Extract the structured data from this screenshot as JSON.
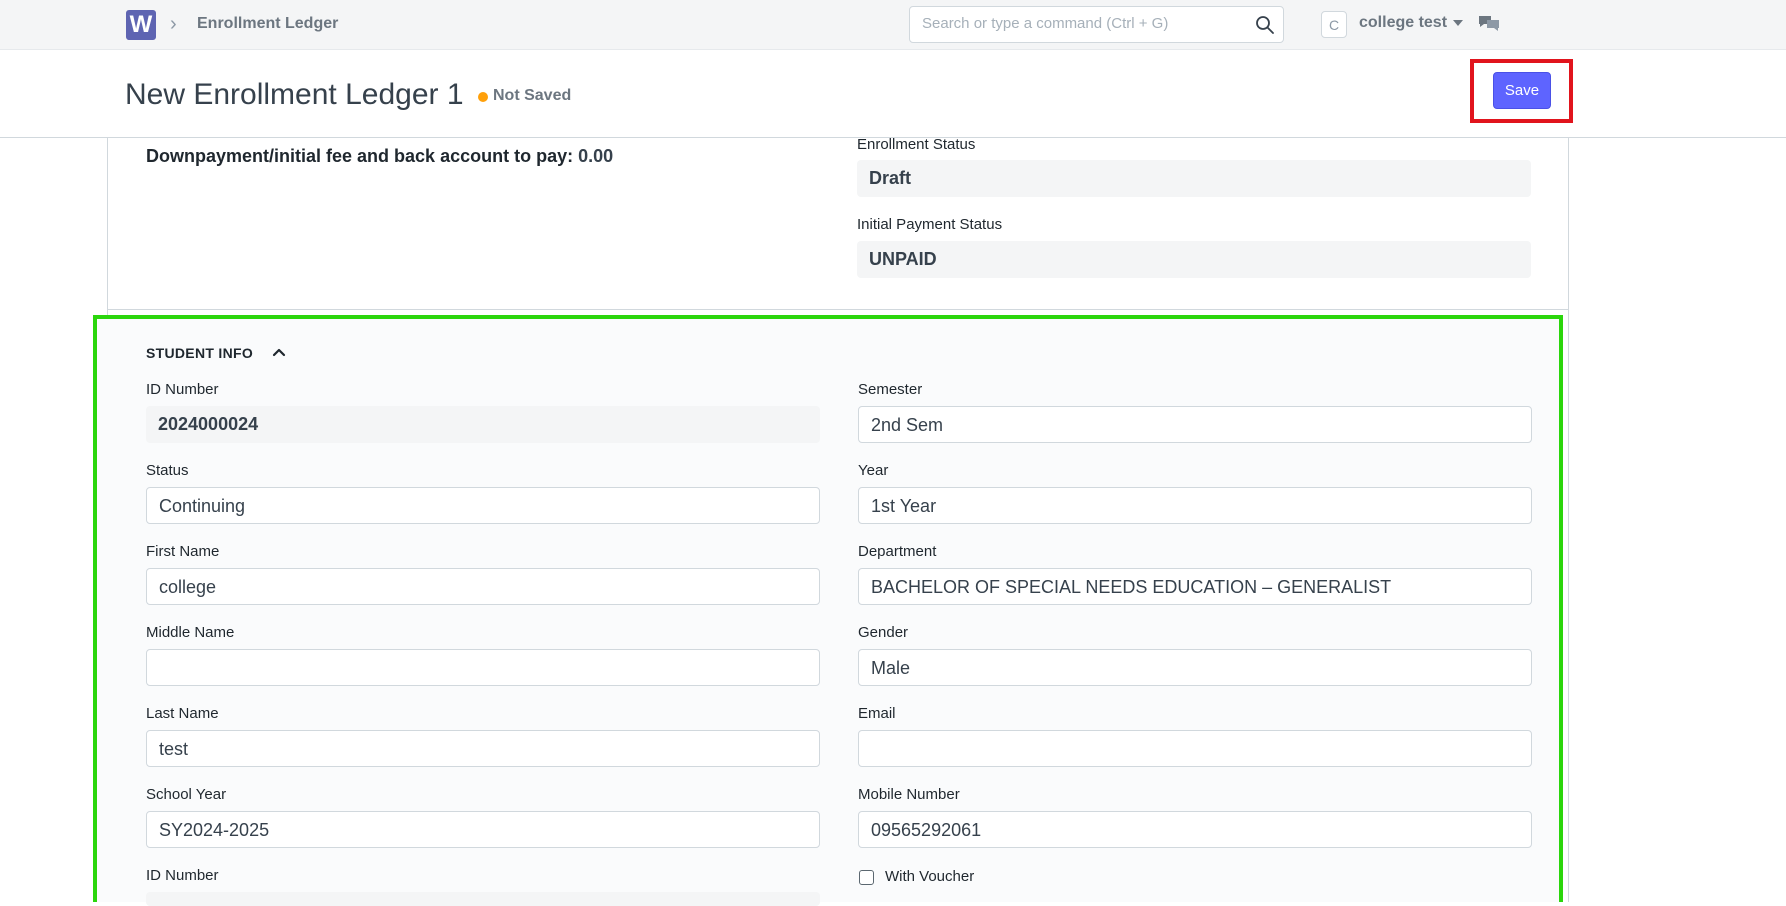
{
  "navbar": {
    "logo_letter": "W",
    "breadcrumb": "Enrollment Ledger",
    "search_placeholder": "Search or type a command (Ctrl + G)",
    "avatar_letter": "C",
    "user_name": "college test"
  },
  "page": {
    "title": "New Enrollment Ledger 1",
    "status": "Not Saved",
    "save_label": "Save"
  },
  "summary": {
    "downpayment_label": "Downpayment/initial fee and back account to pay:",
    "downpayment_value": "0.00",
    "enrollment_status_label": "Enrollment Status",
    "enrollment_status_value": "Draft",
    "initial_payment_status_label": "Initial Payment Status",
    "initial_payment_status_value": "UNPAID"
  },
  "student_info": {
    "heading": "STUDENT INFO",
    "id_number_label": "ID Number",
    "id_number_value": "2024000024",
    "status_label": "Status",
    "status_value": "Continuing",
    "first_name_label": "First Name",
    "first_name_value": "college",
    "middle_name_label": "Middle Name",
    "middle_name_value": "",
    "last_name_label": "Last Name",
    "last_name_value": "test",
    "school_year_label": "School Year",
    "school_year_value": "SY2024-2025",
    "id_number2_label": "ID Number",
    "semester_label": "Semester",
    "semester_value": "2nd Sem",
    "year_label": "Year",
    "year_value": "1st Year",
    "department_label": "Department",
    "department_value": "BACHELOR OF SPECIAL NEEDS EDUCATION – GENERALIST",
    "gender_label": "Gender",
    "gender_value": "Male",
    "email_label": "Email",
    "email_value": "",
    "mobile_label": "Mobile Number",
    "mobile_value": "09565292061",
    "voucher_label": "With Voucher",
    "voucher_checked": false
  },
  "colors": {
    "primary": "#5e64ff",
    "save_highlight": "#e1141d",
    "section_highlight": "#2bd60c",
    "not_saved_dot": "#ffa00a"
  }
}
